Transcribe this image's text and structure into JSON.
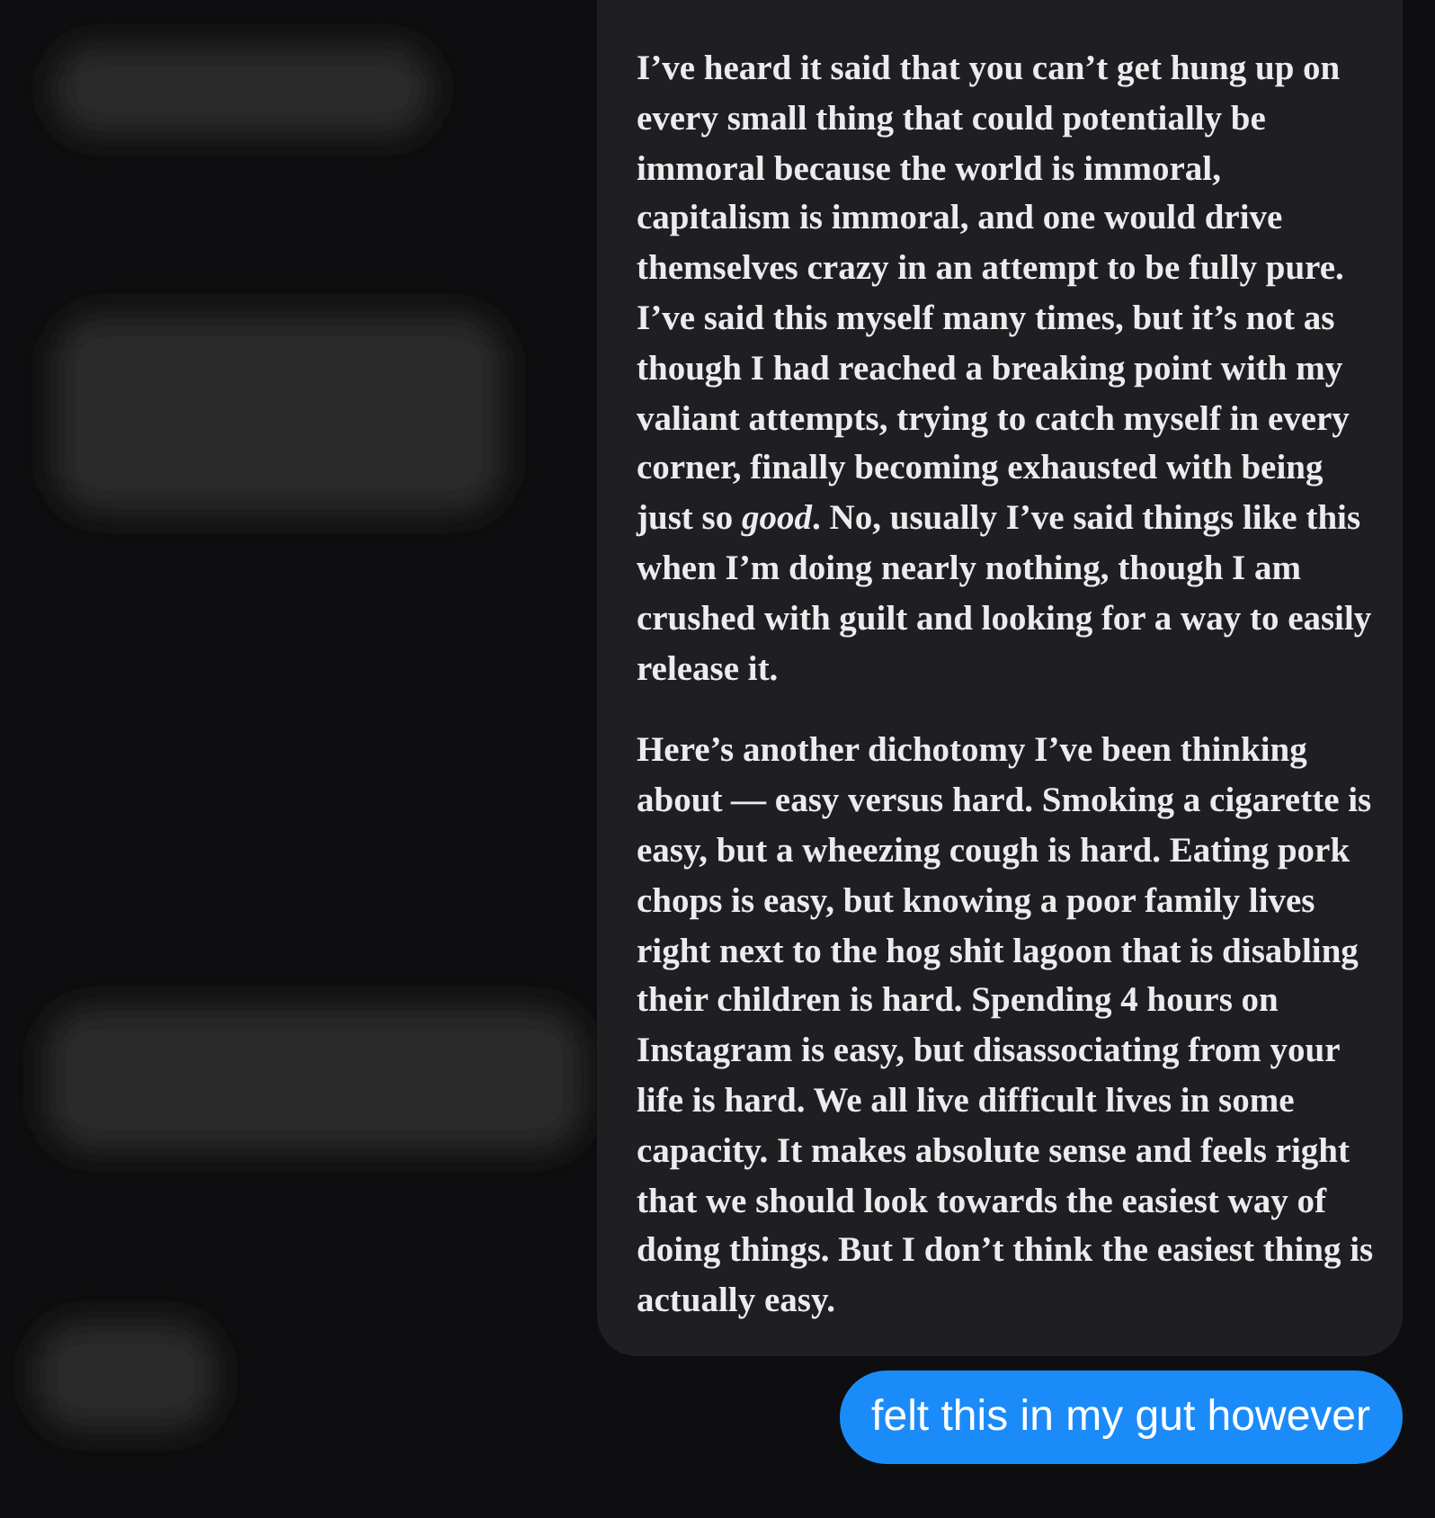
{
  "quote_card": {
    "paragraphs": [
      "I’ve heard it said that you can’t get hung up on every small thing that could potentially be immoral because the world is immoral, capitalism is immoral, and one would drive themselves crazy in an attempt to be fully pure. I’ve said this myself many times, but it’s not as though I had reached a breaking point with my valiant attempts, trying to catch myself in every corner, finally becoming exhausted with being just so *good*. No, usually I’ve said things like this when I’m doing nearly nothing, though I am crushed with guilt and looking for a way to easily release it.",
      "Here’s another dichotomy I’ve been thinking about — easy versus hard. Smoking a cigarette is easy, but a wheezing cough is hard. Eating pork chops is easy, but knowing a poor family lives right next to the hog shit lagoon that is disabling their children is hard. Spending 4 hours on Instagram is easy, but disassociating from your life is hard. We all live difficult lives in some capacity. It makes absolute sense and feels right that we should look towards the easiest way of doing things. But I don’t think the easiest thing is actually easy."
    ]
  },
  "messages": [
    {
      "text": "felt this in my gut however",
      "kind": "sent"
    }
  ]
}
